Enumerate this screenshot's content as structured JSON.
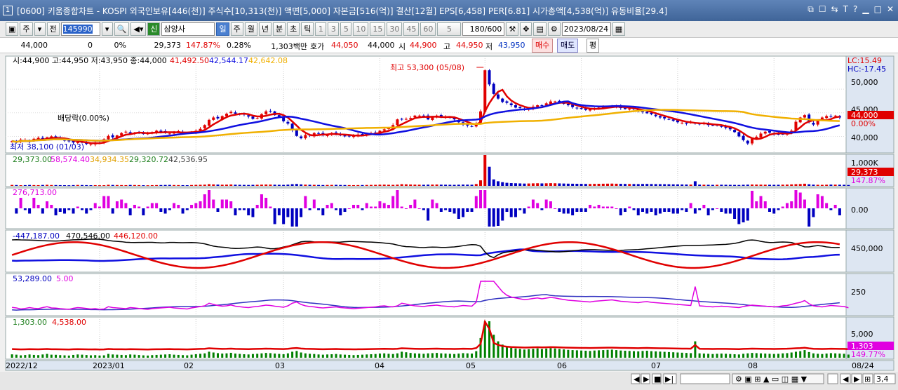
{
  "window": {
    "title": "[0600] 키움종합차트 - KOSPI 외국인보유[446(천)] 주식수[10,313(천)] 액면[5,000] 자본금[516(억)] 결산[12월] EPS[6,458] PER[6.81] 시가총액[4,538(억)] 유동비율[29.4]",
    "num": "1"
  },
  "toolbar": {
    "mode1": "주",
    "mode2": "전",
    "code": "145990",
    "name_badge": "신",
    "name": "삼양사",
    "periods": [
      "일",
      "주",
      "월",
      "년",
      "분",
      "초",
      "틱"
    ],
    "minutes": [
      "1",
      "3",
      "5",
      "10",
      "15",
      "30",
      "45",
      "60"
    ],
    "interval": "5",
    "display_count": "180/600",
    "date": "2023/08/24"
  },
  "quote": {
    "price": "44,000",
    "change": "0",
    "change_pct": "0%",
    "volume": "29,373",
    "vol_ratio": "147.87%",
    "turnover_pct": "0.28%",
    "amount": "1,303백만",
    "hoga_label": "호가",
    "hoga": "44,050",
    "hoga2": "44,000",
    "open_label": "시",
    "open": "44,900",
    "high_label": "고",
    "high": "44,950",
    "low_label": "저",
    "low": "43,950",
    "buy": "매수",
    "sell": "매도",
    "flat": "평"
  },
  "colors": {
    "up": "#e00000",
    "down": "#0000c0",
    "ma5": "#e00000",
    "ma20": "#1010e0",
    "ma60": "#f0b000",
    "magenta": "#e000e0",
    "green": "#008000",
    "bg": "#ffffff",
    "axis_bg": "#dde6f2"
  },
  "chart_data": [
    {
      "type": "candlestick",
      "panel": "price",
      "legend_ohlc": "시:44,900 고:44,950 저:43,950 종:44,000",
      "ma_values": [
        "41,492.50",
        "42,544.17",
        "42,642.08"
      ],
      "right_top_labels": [
        "LC:15.49",
        "HC:-17.45"
      ],
      "yticks": [
        "50,000",
        "45,000",
        "40,000"
      ],
      "ylim": [
        36500,
        57000
      ],
      "last_label": "44,000",
      "last_pct": "0.00%",
      "annotations": {
        "max_text": "최고 53,300 (05/08)",
        "min_text": "최저 38,100 (01/03)",
        "div_text": "배당락(0.00%)"
      },
      "closes": [
        39000,
        38700,
        39300,
        39200,
        38900,
        39500,
        39700,
        39400,
        39800,
        40000,
        39600,
        39400,
        39100,
        39000,
        38700,
        38800,
        38700,
        38400,
        38300,
        38600,
        38700,
        39400,
        40100,
        39800,
        40200,
        40700,
        41000,
        40600,
        40800,
        40900,
        40500,
        40600,
        40900,
        41200,
        41000,
        40700,
        40600,
        40900,
        41100,
        40800,
        40700,
        40900,
        41200,
        41600,
        42400,
        43500,
        44000,
        43800,
        44300,
        44800,
        45200,
        44800,
        44700,
        44600,
        44200,
        43700,
        43900,
        44700,
        45300,
        45400,
        44500,
        44100,
        43200,
        42700,
        41300,
        40100,
        39600,
        40300,
        40200,
        40700,
        40600,
        40200,
        40400,
        40700,
        40600,
        40200,
        40000,
        40000,
        40200,
        40400,
        40300,
        40600,
        40700,
        40800,
        41200,
        41500,
        41700,
        42400,
        43600,
        43700,
        43700,
        43900,
        44400,
        44400,
        44300,
        43600,
        44100,
        44400,
        44200,
        44100,
        43900,
        43600,
        43000,
        42500,
        42300,
        42100,
        42800,
        45300,
        54000,
        51000,
        49000,
        48000,
        47300,
        47100,
        46600,
        46100,
        46000,
        45700,
        45800,
        46300,
        46600,
        46500,
        47000,
        47400,
        47400,
        47200,
        46900,
        46600,
        46200,
        46000,
        45800,
        45600,
        45800,
        45900,
        46100,
        46200,
        46300,
        46400,
        46400,
        46000,
        45800,
        45900,
        45800,
        45400,
        45200,
        44900,
        44700,
        44300,
        44000,
        43800,
        43600,
        43300,
        43000,
        42900,
        42700,
        43000,
        42700,
        42600,
        42800,
        42400,
        42300,
        42300,
        42100,
        41800,
        41500,
        40900,
        40000,
        39200,
        38500,
        39500,
        39900,
        40600,
        41000,
        40800,
        40500,
        40400,
        40500,
        40800,
        41200,
        43100,
        44000,
        44500,
        43000,
        42500,
        43300,
        44000,
        44300,
        44200,
        44400,
        44000
      ]
    },
    {
      "type": "bar",
      "panel": "volume",
      "legend_values": [
        "29,373.00",
        "58,574.40",
        "34,934.35",
        "29,320.72",
        "42,536.95"
      ],
      "yticks": [
        "1,000K"
      ],
      "last_label": "29,373",
      "last_pct": "147.87%",
      "values_k": [
        31,
        28,
        22,
        25,
        30,
        26,
        24,
        30,
        35,
        28,
        27,
        24,
        22,
        20,
        26,
        30,
        28,
        25,
        22,
        24,
        20,
        22,
        35,
        30,
        28,
        26,
        24,
        30,
        28,
        25,
        22,
        20,
        24,
        26,
        28,
        30,
        32,
        28,
        26,
        24,
        22,
        28,
        32,
        36,
        40,
        55,
        48,
        42,
        38,
        40,
        45,
        38,
        35,
        32,
        30,
        34,
        36,
        40,
        44,
        42,
        38,
        35,
        32,
        40,
        55,
        62,
        48,
        40,
        36,
        34,
        30,
        28,
        30,
        32,
        34,
        30,
        28,
        26,
        24,
        26,
        28,
        30,
        32,
        34,
        38,
        40,
        36,
        34,
        40,
        55,
        50,
        44,
        40,
        38,
        36,
        40,
        42,
        44,
        40,
        38,
        36,
        34,
        38,
        42,
        40,
        38,
        60,
        180,
        1000,
        620,
        210,
        150,
        120,
        100,
        90,
        85,
        80,
        75,
        78,
        82,
        85,
        80,
        84,
        88,
        85,
        80,
        76,
        72,
        70,
        68,
        66,
        64,
        62,
        66,
        68,
        70,
        72,
        74,
        70,
        66,
        64,
        62,
        60,
        58,
        62,
        64,
        60,
        58,
        56,
        54,
        52,
        50,
        48,
        46,
        44,
        42,
        150,
        40,
        38,
        36,
        34,
        36,
        38,
        36,
        34,
        32,
        30,
        36,
        40,
        44,
        42,
        40,
        38,
        36,
        34,
        36,
        40,
        42,
        48,
        55,
        60,
        70,
        52,
        40,
        36,
        34,
        38,
        42,
        40,
        38,
        36,
        29
      ]
    },
    {
      "type": "bar",
      "panel": "oscillator",
      "legend_values": [
        "276,713.00"
      ],
      "yticks": [
        "0.00"
      ],
      "ylim": [
        -1000,
        1000
      ]
    },
    {
      "type": "line",
      "panel": "investor",
      "legend_values": [
        "-447,187.00",
        "470,546.00",
        "446,120.00"
      ],
      "yticks": [
        "450,000"
      ]
    },
    {
      "type": "line",
      "panel": "index",
      "legend_values": [
        "53,289.00",
        "5.00"
      ],
      "yticks": [
        "250"
      ]
    },
    {
      "type": "line",
      "panel": "amount",
      "legend_values": [
        "1,303.00",
        "4,538.00"
      ],
      "yticks": [
        "5,000"
      ],
      "last_label": "1,303",
      "last_pct": "149.77%"
    },
    {
      "type": "axis",
      "panel": "xaxis",
      "labels": [
        "2022/12",
        "2023/01",
        "02",
        "03",
        "04",
        "05",
        "06",
        "07",
        "08",
        "08/24"
      ]
    }
  ]
}
